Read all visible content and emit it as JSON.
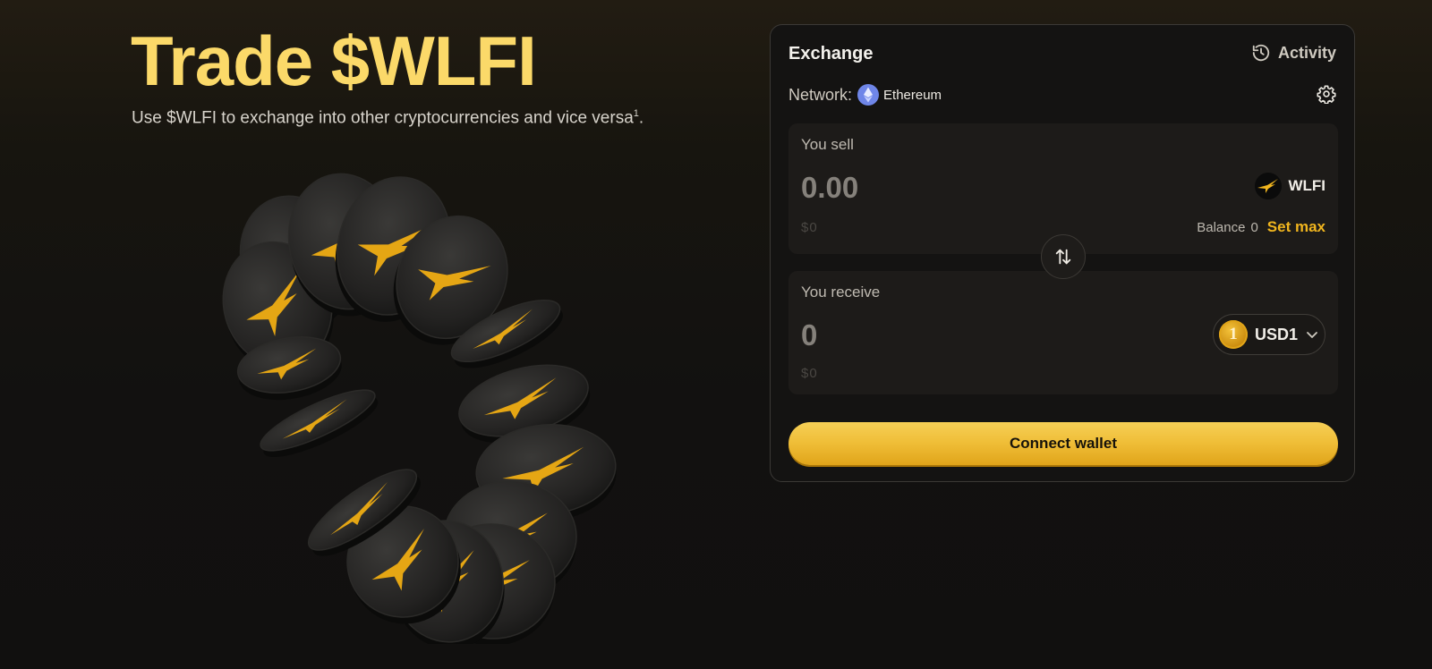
{
  "hero": {
    "title": "Trade $WLFI",
    "subtitle": "Use $WLFI to exchange into other cryptocurrencies and vice versa",
    "footnote": "1",
    "subtitle_end": "."
  },
  "exchange": {
    "title": "Exchange",
    "activity_label": "Activity",
    "network_label": "Network:",
    "network_name": "Ethereum",
    "sell": {
      "label": "You sell",
      "amount_placeholder": "0.00",
      "usd_value": "$0",
      "token": "WLFI",
      "balance_label": "Balance",
      "balance_value": "0",
      "set_max_label": "Set max"
    },
    "receive": {
      "label": "You receive",
      "amount_placeholder": "0",
      "usd_value": "$0",
      "token": "USD1",
      "token_glyph": "1"
    },
    "connect_label": "Connect wallet"
  },
  "colors": {
    "accent": "#f0b51e",
    "title": "#fbd969",
    "ethereum": "#6f86e8"
  },
  "icons": [
    "history-icon",
    "ethereum-icon",
    "gear-icon",
    "wlfi-eagle-icon",
    "swap-arrows-icon",
    "usd1-coin-icon",
    "chevron-down-icon"
  ]
}
